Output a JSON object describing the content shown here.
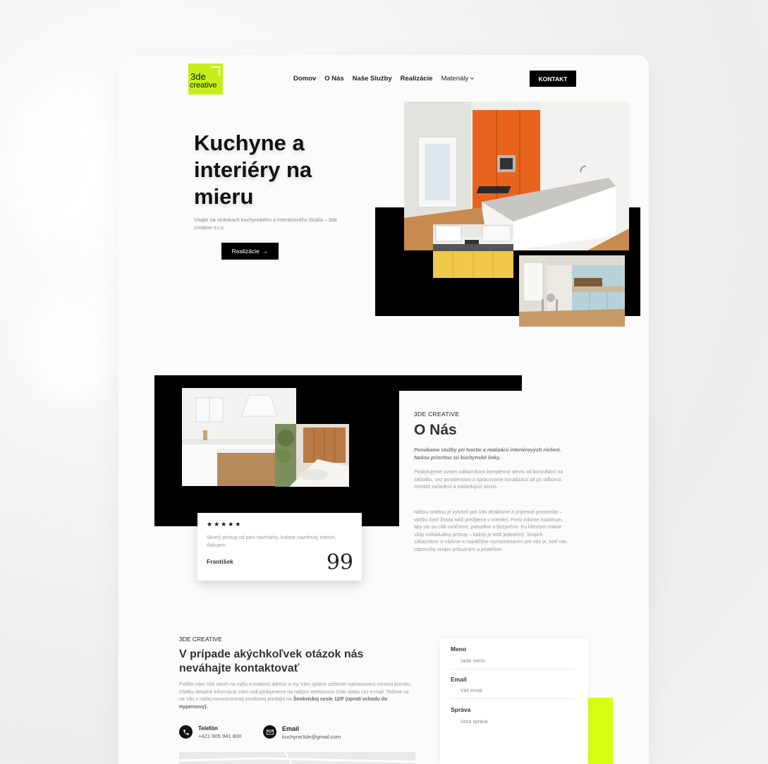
{
  "header": {
    "logo_line1": "3de",
    "logo_line2": "creative",
    "nav": [
      "Domov",
      "O Nás",
      "Naše Služby",
      "Realizácie",
      "Materiály"
    ],
    "dropdown_icon": "chevron-down-icon",
    "cta": "KONTAKT"
  },
  "hero": {
    "title": "Kuchyne a interiéry na mieru",
    "subtitle": "Vitajte na stránkach kuchynského a interiérového štúdia – 3de creative s.r.o.",
    "button": "Realizácie",
    "button_arrow": "→"
  },
  "about": {
    "tag": "3DE CREATIVE",
    "title": "O Nás",
    "lead": "Ponúkame služby pri tvorbe a realizácii interiérových riešení. Našou prioritou sú kuchynské linky.",
    "p1": "Poskytujeme svojim zákazníkom komplexný servis od konzultácií na začiatku, cez poradenstvo a spracovanie vizualizácií až po odbornú montáž zariadení a nasledujúci servis.",
    "p2": "Našou snahou je vytvoriť pre Vás atraktívne a príjemné prostredie – väčšiu časť života totiž prežijeme v interiéri. Preto robíme maximum, aby ste sa cítili uvoľnene, pohodlne a bezpečne. Ku klientom máme vždy individuálny prístup – každý je totiž jedinečný. Svojich zákazníkov si vážime a najväčším vyznamenaním pre nás je, keď nás odporučia svojim príbuzným a priateľom."
  },
  "review": {
    "stars": "★★★★★",
    "rating": 5,
    "text": "Skvelý prístup od pani návrhárky, krásne navrhnutý interiér, ďakujem.",
    "name": "František",
    "quote_icon": "quote-icon"
  },
  "contact": {
    "tag": "3DE CREATIVE",
    "title": "V prípade akýchkoľvek otázok nás neváhajte kontaktovať",
    "text": "Pošlite nám Váš návrh na našu e-mailovú adresu a my Vám spätne zašleme vypracovanú cenovú ponuku. Všetky detailné informácie Vám radi poskytneme na našom telefónnom čísle alebo cez e-mail. Tešíme sa na Vás v našej novootvorenej vzorkovej predajni na ",
    "address": "Šenkvickej ceste 12/F (oproti vchodu do Hypernovy).",
    "phone_label": "Telefón",
    "phone": "+421 905 941 800",
    "email_label": "Email",
    "email": "kuchyne3de@gmail.com",
    "phone_icon": "phone-icon",
    "email_icon": "mail-icon"
  },
  "form": {
    "name_label": "Meno",
    "name_placeholder": "Vaše meno",
    "email_label": "Email",
    "email_placeholder": "Váš email",
    "message_label": "Správa",
    "message_placeholder": "Vaša správa"
  },
  "colors": {
    "accent": "#c6ef1a",
    "lime_block": "#d6ff12",
    "dark": "#000000",
    "kitchen_orange": "#e8641e"
  }
}
